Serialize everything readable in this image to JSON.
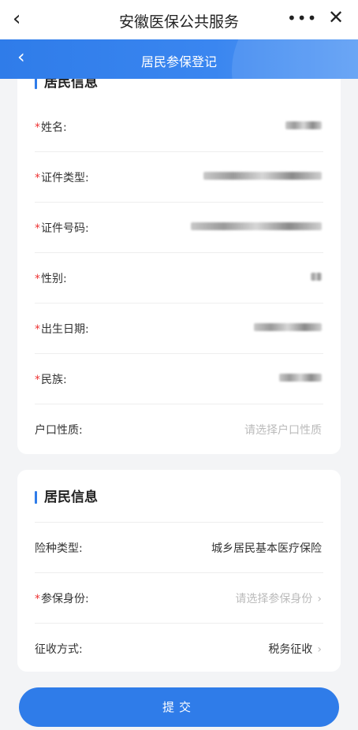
{
  "topbar": {
    "back_icon": "‹",
    "title": "安徽医保公共服务",
    "more_icon": "•••",
    "close_icon": "✕"
  },
  "subbar": {
    "back_icon": "‹",
    "title": "居民参保登记"
  },
  "section1": {
    "title": "居民信息",
    "fields": [
      {
        "label": "姓名:",
        "required": true,
        "value": ""
      },
      {
        "label": "证件类型:",
        "required": true,
        "value": ""
      },
      {
        "label": "证件号码:",
        "required": true,
        "value": ""
      },
      {
        "label": "性别:",
        "required": true,
        "value": ""
      },
      {
        "label": "出生日期:",
        "required": true,
        "value": ""
      },
      {
        "label": "民族:",
        "required": true,
        "value": ""
      },
      {
        "label": "户口性质:",
        "required": false,
        "placeholder": "请选择户口性质"
      }
    ]
  },
  "section2": {
    "title": "居民信息",
    "fields": [
      {
        "label": "险种类型:",
        "required": false,
        "value": "城乡居民基本医疗保险"
      },
      {
        "label": "参保身份:",
        "required": true,
        "placeholder": "请选择参保身份"
      },
      {
        "label": "征收方式:",
        "required": false,
        "value": "税务征收"
      }
    ]
  },
  "submit_label": "提交",
  "required_mark": "*",
  "chevron": "›",
  "colors": {
    "accent": "#2f7ce9",
    "required": "#e33333",
    "placeholder": "#bbbbbb"
  }
}
